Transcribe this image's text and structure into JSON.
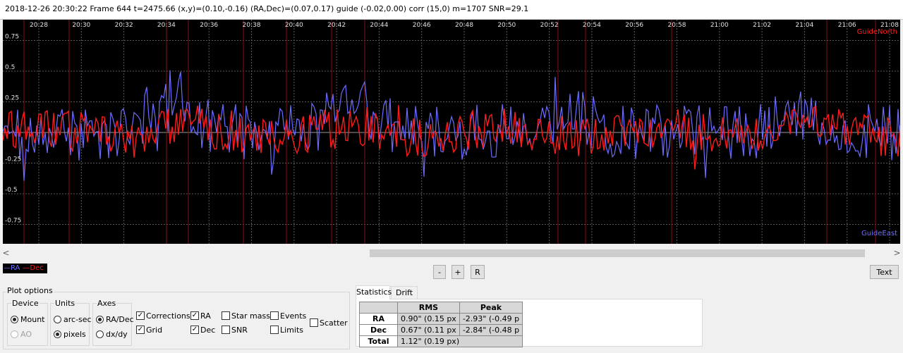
{
  "status_line": "2018-12-26 20:30:22 Frame 644 t=2475.66 (x,y)=(0.10,-0.16) (RA,Dec)=(0.07,0.17) guide (-0.02,0.00) corr (15,0) m=1707 SNR=29.1",
  "graph": {
    "time_labels": [
      "20:28",
      "20:30",
      "20:32",
      "20:34",
      "20:36",
      "20:38",
      "20:40",
      "20:42",
      "20:44",
      "20:46",
      "20:48",
      "20:50",
      "20:52",
      "20:54",
      "20:56",
      "20:58",
      "21:00",
      "21:02",
      "21:04",
      "21:06",
      "21:08"
    ],
    "y_labels": [
      "0.75",
      "0.5",
      "0.25",
      "-0.25",
      "-0.5",
      "-0.75"
    ],
    "y_ticks": [
      0.75,
      0.5,
      0.25,
      -0.25,
      -0.5,
      -0.75
    ],
    "north_label": "GuideNorth",
    "east_label": "GuideEast",
    "ra_color": "#6c6cff",
    "dec_color": "#ff1a1a",
    "grid_color": "#5a5a5a"
  },
  "scroll": {
    "left_arrow": "<",
    "right_arrow": ">"
  },
  "legend": {
    "ra": "—RA",
    "dec": "—Dec"
  },
  "buttons": {
    "minus": "-",
    "plus": "+",
    "reset": "R",
    "text": "Text"
  },
  "plot_options": {
    "title": "Plot options",
    "device": {
      "title": "Device",
      "mount": "Mount",
      "ao": "AO"
    },
    "units": {
      "title": "Units",
      "arcsec": "arc-sec",
      "pixels": "pixels"
    },
    "axes": {
      "title": "Axes",
      "radec": "RA/Dec",
      "dxdy": "dx/dy"
    },
    "checks": {
      "corrections": "Corrections",
      "ra": "RA",
      "star_mass": "Star mass",
      "events": "Events",
      "grid": "Grid",
      "dec": "Dec",
      "snr": "SNR",
      "limits": "Limits",
      "scatter": "Scatter"
    }
  },
  "tabs": {
    "statistics": "Statistics",
    "drift": "Drift"
  },
  "stats": {
    "headers": [
      "RMS",
      "Peak"
    ],
    "rows": [
      {
        "label": "RA",
        "rms": "0.90\" (0.15 px",
        "peak": "-2.93\" (-0.49 p"
      },
      {
        "label": "Dec",
        "rms": "0.67\" (0.11 px",
        "peak": "-2.84\" (-0.48 p"
      },
      {
        "label": "Total",
        "rms": "1.12\" (0.19 px)",
        "peak": ""
      }
    ]
  }
}
